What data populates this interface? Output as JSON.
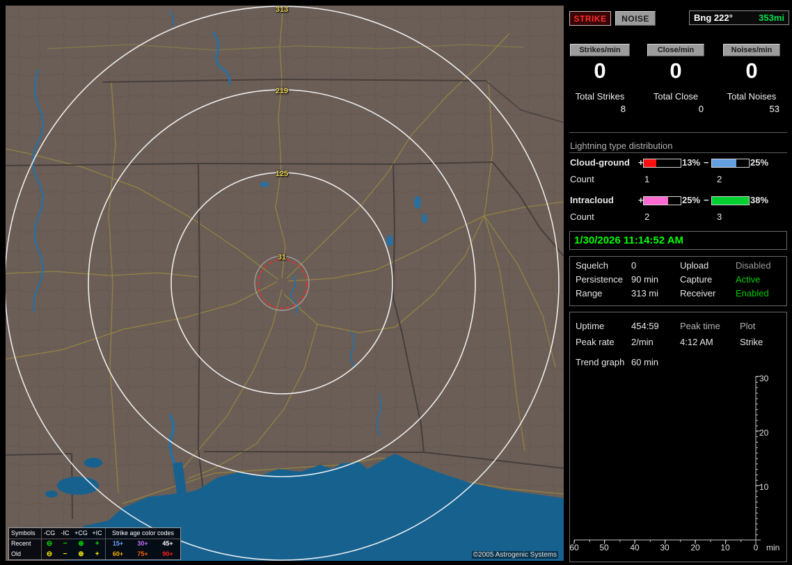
{
  "map": {
    "rings": [
      "313",
      "219",
      "125",
      "31"
    ],
    "copyright": "©2005 Astrogenic Systems",
    "legend": {
      "symbols_title": "Symbols",
      "age_title": "Strike age color codes",
      "columns": [
        "-CG",
        "-IC",
        "+CG",
        "+IC"
      ],
      "glyphs": [
        "⊖",
        "−",
        "⊕",
        "+"
      ],
      "rows": [
        {
          "label": "Recent",
          "symbol_color": "#00e000",
          "ages": [
            {
              "text": "15+",
              "color": "#6aaaff"
            },
            {
              "text": "30+",
              "color": "#c678ff"
            },
            {
              "text": "45+",
              "color": "#ffffff"
            }
          ]
        },
        {
          "label": "Old",
          "symbol_color": "#ffee00",
          "ages": [
            {
              "text": "60+",
              "color": "#ffb000"
            },
            {
              "text": "75+",
              "color": "#ff6400"
            },
            {
              "text": "90+",
              "color": "#ff2020"
            }
          ]
        }
      ]
    }
  },
  "panel": {
    "strike_button": "STRIKE",
    "noise_button": "NOISE",
    "bearing": {
      "label": "Bng 222°",
      "value": "353mi",
      "value_color": "#00e050"
    },
    "rates": [
      {
        "header": "Strikes/min",
        "value": "0",
        "total_label": "Total Strikes",
        "total_value": "8"
      },
      {
        "header": "Close/min",
        "value": "0",
        "total_label": "Total Close",
        "total_value": "0"
      },
      {
        "header": "Noises/min",
        "value": "0",
        "total_label": "Total Noises",
        "total_value": "53"
      }
    ],
    "distribution": {
      "title": "Lightning type distribution",
      "plus": "+",
      "minus": "−",
      "count_label": "Count",
      "rows": [
        {
          "name": "Cloud-ground",
          "plus_pct": "13%",
          "plus_fill": 34,
          "plus_color": "#ff1010",
          "minus_pct": "25%",
          "minus_fill": 66,
          "minus_color": "#63a0e0",
          "plus_count": "1",
          "minus_count": "2"
        },
        {
          "name": "Intracloud",
          "plus_pct": "25%",
          "plus_fill": 66,
          "plus_color": "#ff6ad0",
          "minus_pct": "38%",
          "minus_fill": 100,
          "minus_color": "#00d030",
          "plus_count": "2",
          "minus_count": "3"
        }
      ]
    },
    "clock": "1/30/2026 11:14:52 AM",
    "status": [
      {
        "l1": "Squelch",
        "v1": "0",
        "l2": "Upload",
        "v2": "Disabled",
        "v2_color": "#9a9a9a"
      },
      {
        "l1": "Persistence",
        "v1": "90 min",
        "l2": "Capture",
        "v2": "Active",
        "v2_color": "#00cc00"
      },
      {
        "l1": "Range",
        "v1": "313 mi",
        "l2": "Receiver",
        "v2": "Enabled",
        "v2_color": "#00cc00"
      }
    ],
    "stats": {
      "uptime_label": "Uptime",
      "uptime_value": "454:59",
      "peak_time_label": "Peak time",
      "plot_label": "Plot",
      "peak_rate_label": "Peak rate",
      "peak_rate_value": "2/min",
      "peak_time_value": "4:12 AM",
      "plot_value": "Strike",
      "trend_label": "Trend graph",
      "trend_value": "60 min"
    },
    "trend_chart": {
      "type": "line",
      "series": [],
      "y_ticks": [
        "30",
        "20",
        "10"
      ],
      "x_ticks": [
        "60",
        "50",
        "40",
        "30",
        "20",
        "10",
        "0"
      ],
      "x_unit": "min",
      "ylim": [
        0,
        30
      ],
      "xlim_minutes_ago": [
        60,
        0
      ]
    }
  }
}
